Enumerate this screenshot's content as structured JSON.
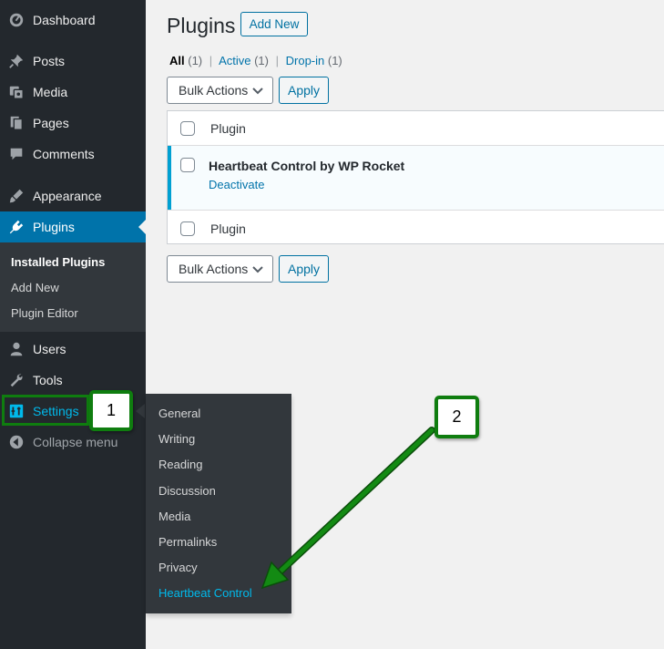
{
  "sidebar": {
    "items": [
      {
        "label": "Dashboard",
        "icon": "dashboard-icon"
      },
      {
        "label": "Posts",
        "icon": "pin-icon"
      },
      {
        "label": "Media",
        "icon": "media-icon"
      },
      {
        "label": "Pages",
        "icon": "pages-icon"
      },
      {
        "label": "Comments",
        "icon": "comment-icon"
      },
      {
        "label": "Appearance",
        "icon": "paintbrush-icon"
      },
      {
        "label": "Plugins",
        "icon": "plugin-icon"
      },
      {
        "label": "Users",
        "icon": "user-icon"
      },
      {
        "label": "Tools",
        "icon": "wrench-icon"
      },
      {
        "label": "Settings",
        "icon": "settings-icon"
      },
      {
        "label": "Collapse menu",
        "icon": "collapse-icon"
      }
    ],
    "submenu": [
      "Installed Plugins",
      "Add New",
      "Plugin Editor"
    ]
  },
  "flyout": [
    "General",
    "Writing",
    "Reading",
    "Discussion",
    "Media",
    "Permalinks",
    "Privacy",
    "Heartbeat Control"
  ],
  "badges": {
    "one": "1",
    "two": "2"
  },
  "main": {
    "title": "Plugins",
    "add_new": "Add New",
    "views": {
      "all": "All",
      "all_count": "(1)",
      "active": "Active",
      "active_count": "(1)",
      "dropin": "Drop-in",
      "dropin_count": "(1)",
      "separator": "|"
    },
    "bulk_actions": "Bulk Actions",
    "apply": "Apply",
    "table": {
      "header": "Plugin",
      "footer": "Plugin",
      "row": {
        "name": "Heartbeat Control by WP Rocket",
        "action": "Deactivate"
      }
    }
  },
  "colors": {
    "sidebar_bg": "#23282d",
    "accent": "#0073aa",
    "highlight_text": "#00b9eb",
    "annotation_green": "#0f7d0f"
  }
}
